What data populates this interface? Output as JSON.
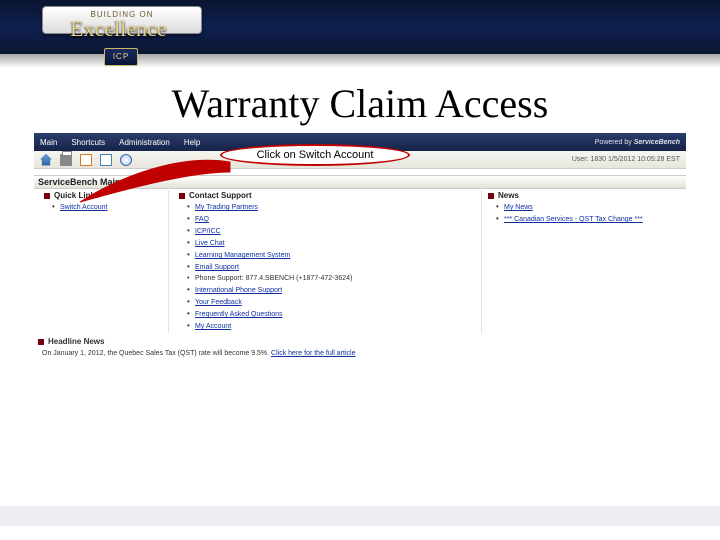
{
  "badge": {
    "top_text": "BUILDING ON",
    "script": "Excellence",
    "icp": "ICP"
  },
  "slide": {
    "title": "Warranty Claim Access"
  },
  "callout": {
    "text": "Click on Switch Account"
  },
  "menubar": {
    "items": [
      "Main",
      "Shortcuts",
      "Administration",
      "Help"
    ],
    "powered_prefix": "Powered by",
    "powered_brand": "ServiceBench"
  },
  "toolbar": {
    "user_line": "User: 1830 1/5/2012 10:05:28 EST"
  },
  "main_menu_title": "ServiceBench Main Menu",
  "columns": {
    "quick": {
      "title": "Quick Links",
      "items": [
        "Switch Account"
      ]
    },
    "support": {
      "title": "Contact Support",
      "links": [
        "My Trading Partners",
        "FAQ",
        "ICP/ICC",
        "Live Chat",
        "Learning Management System",
        "Email Support"
      ],
      "phone_line": "Phone Support: 877.4.SBENCH (+1877-472-3624)",
      "after_phone": [
        "International Phone Support",
        "Your Feedback",
        "Frequently Asked Questions",
        "My Account"
      ]
    },
    "news": {
      "title": "News",
      "items": [
        "My News",
        "*** Canadian Services - QST Tax Change ***"
      ]
    }
  },
  "headline": {
    "title": "Headline News",
    "body_prefix": "On January 1, 2012, the Quebec Sales Tax (QST) rate will become 9.5%. ",
    "link": "Click here for the full article"
  }
}
